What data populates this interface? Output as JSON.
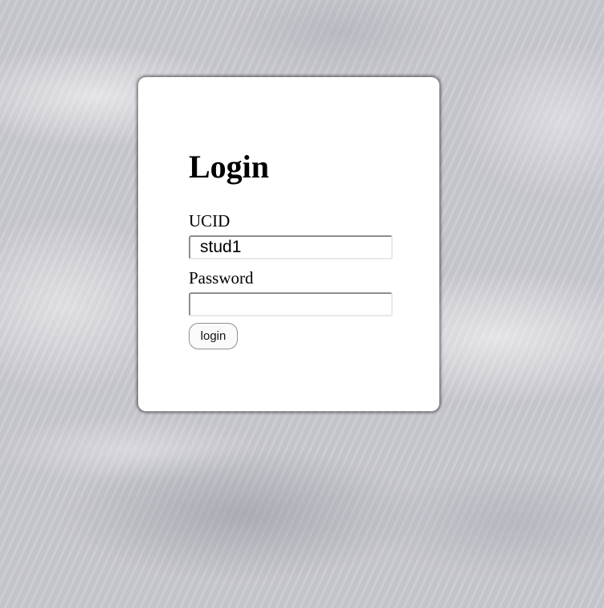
{
  "login": {
    "title": "Login",
    "ucid_label": "UCID",
    "ucid_value": "stud1",
    "password_label": "Password",
    "password_value": "",
    "submit_label": "login"
  },
  "colors": {
    "card_background": "#ffffff",
    "page_background": "#c9c9d0"
  }
}
